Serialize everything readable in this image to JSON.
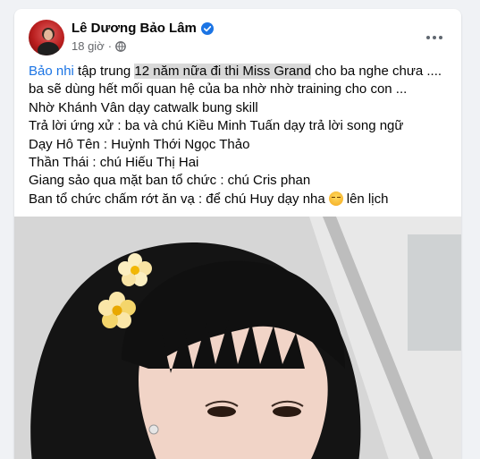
{
  "post": {
    "author": "Lê Dương Bảo Lâm",
    "verified": true,
    "time": "18 giờ",
    "audience_icon": "globe-icon",
    "more_icon": "more-horizontal-icon",
    "lines": {
      "l1_mention": "Bảo nhi",
      "l1_a": " tập trung ",
      "l1_highlight": "12 năm nữa đi thi Miss Grand",
      "l1_b": " cho ba nghe chưa ....",
      "l2": "ba sẽ dùng hết mối quan hệ của ba nhờ nhờ training cho con ...",
      "l3": "Nhờ Khánh Vân dạy catwalk bung skill",
      "l4": "Trả lời ứng xử : ba và chú Kiều Minh Tuấn dạy trả lời song ngữ",
      "l5": "Dạy Hô Tên : Huỳnh Thới Ngọc Thảo",
      "l6": "Thần Thái : chú Hiếu Thị Hai",
      "l7": "Giang sảo qua mặt ban tổ chức : chú Cris phan",
      "l8_a": "Ban tổ chức chấm rớt ăn vạ : để chú Huy dạy nha",
      "l8_emoji": "smirk-emoji",
      "l8_b": "lên lịch"
    },
    "colors": {
      "link": "#1b74e4",
      "text": "#050505",
      "meta": "#65676b",
      "highlight": "#d8d8d8"
    }
  }
}
